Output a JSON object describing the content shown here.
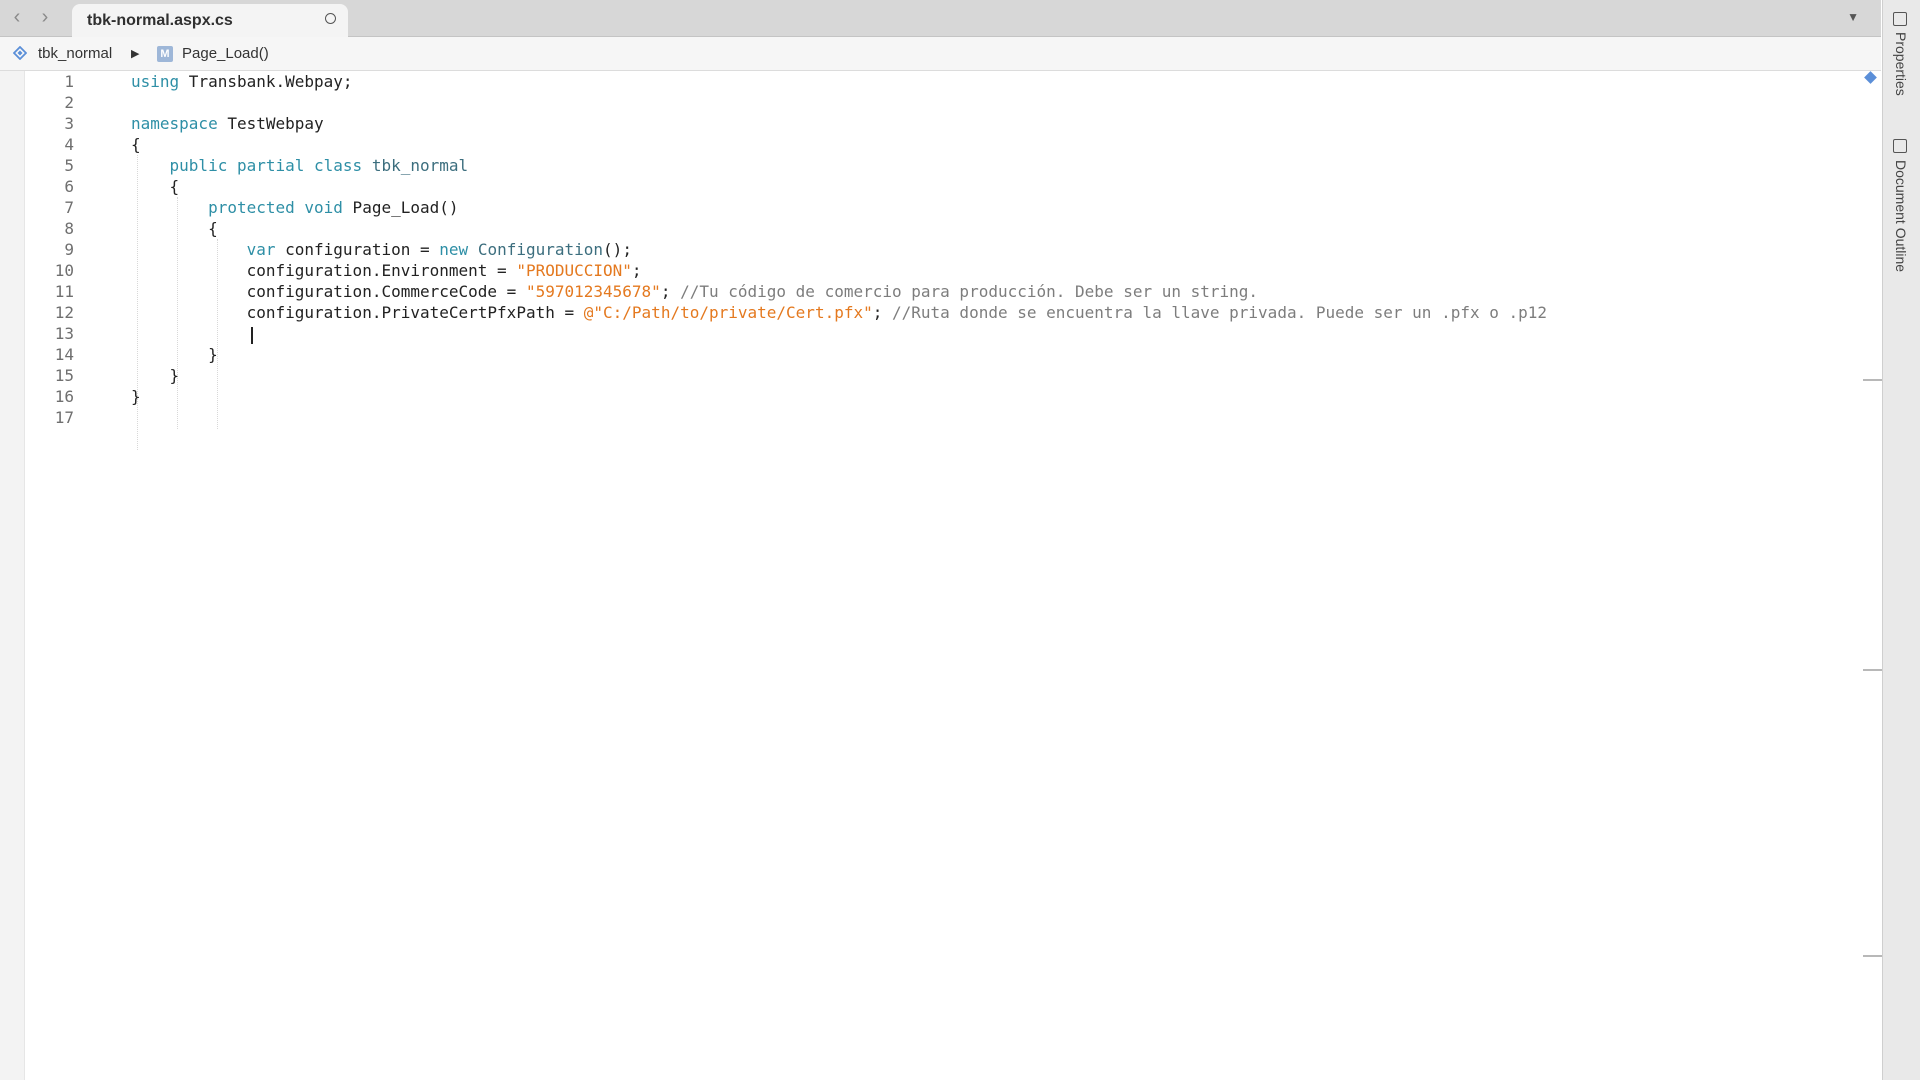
{
  "nav": {
    "back_icon": "chevron-left-icon",
    "forward_icon": "chevron-right-icon"
  },
  "tab": {
    "title": "tbk-normal.aspx.cs",
    "overflow_icon": "chevron-down-icon"
  },
  "breadcrumb": {
    "class_name": "tbk_normal",
    "separator": "▶",
    "method_badge": "M",
    "method_name": "Page_Load()"
  },
  "side_panel": {
    "properties_label": "Properties",
    "outline_label": "Document Outline"
  },
  "colors": {
    "keyword": "#2e8fa6",
    "string": "#e4791f",
    "comment": "#7d7d7d",
    "marker": "#5b8fd8"
  },
  "code": {
    "lines": [
      {
        "n": "1",
        "t": [
          {
            "c": "kw",
            "v": "using"
          },
          {
            "c": "",
            "v": " Transbank.Webpay;"
          }
        ]
      },
      {
        "n": "2",
        "t": []
      },
      {
        "n": "3",
        "t": [
          {
            "c": "kw",
            "v": "namespace"
          },
          {
            "c": "",
            "v": " TestWebpay"
          }
        ]
      },
      {
        "n": "4",
        "t": [
          {
            "c": "",
            "v": "{"
          }
        ]
      },
      {
        "n": "5",
        "t": [
          {
            "c": "",
            "v": "    "
          },
          {
            "c": "kw",
            "v": "public partial class"
          },
          {
            "c": "",
            "v": " "
          },
          {
            "c": "ty",
            "v": "tbk_normal"
          }
        ]
      },
      {
        "n": "6",
        "t": [
          {
            "c": "",
            "v": "    {"
          }
        ]
      },
      {
        "n": "7",
        "t": [
          {
            "c": "",
            "v": "        "
          },
          {
            "c": "kw",
            "v": "protected void"
          },
          {
            "c": "",
            "v": " Page_Load()"
          }
        ]
      },
      {
        "n": "8",
        "t": [
          {
            "c": "",
            "v": "        {"
          }
        ]
      },
      {
        "n": "9",
        "t": [
          {
            "c": "",
            "v": "            "
          },
          {
            "c": "kw",
            "v": "var"
          },
          {
            "c": "",
            "v": " configuration = "
          },
          {
            "c": "kw",
            "v": "new"
          },
          {
            "c": "",
            "v": " "
          },
          {
            "c": "ty",
            "v": "Configuration"
          },
          {
            "c": "",
            "v": "();"
          }
        ]
      },
      {
        "n": "10",
        "t": [
          {
            "c": "",
            "v": "            configuration.Environment = "
          },
          {
            "c": "str",
            "v": "\"PRODUCCION\""
          },
          {
            "c": "",
            "v": ";"
          }
        ]
      },
      {
        "n": "11",
        "t": [
          {
            "c": "",
            "v": "            configuration.CommerceCode = "
          },
          {
            "c": "str",
            "v": "\"597012345678\""
          },
          {
            "c": "",
            "v": "; "
          },
          {
            "c": "cm",
            "v": "//Tu código de comercio para producción. Debe ser un string."
          }
        ]
      },
      {
        "n": "12",
        "t": [
          {
            "c": "",
            "v": "            configuration.PrivateCertPfxPath = "
          },
          {
            "c": "str",
            "v": "@\"C:/Path/to/private/Cert.pfx\""
          },
          {
            "c": "",
            "v": "; "
          },
          {
            "c": "cm",
            "v": "//Ruta donde se encuentra la llave privada. Puede ser un .pfx o .p12"
          }
        ]
      },
      {
        "n": "13",
        "t": []
      },
      {
        "n": "14",
        "t": [
          {
            "c": "",
            "v": "        }"
          }
        ]
      },
      {
        "n": "15",
        "t": [
          {
            "c": "",
            "v": "    }"
          }
        ]
      },
      {
        "n": "16",
        "t": [
          {
            "c": "",
            "v": "}"
          }
        ]
      },
      {
        "n": "17",
        "t": []
      }
    ]
  }
}
